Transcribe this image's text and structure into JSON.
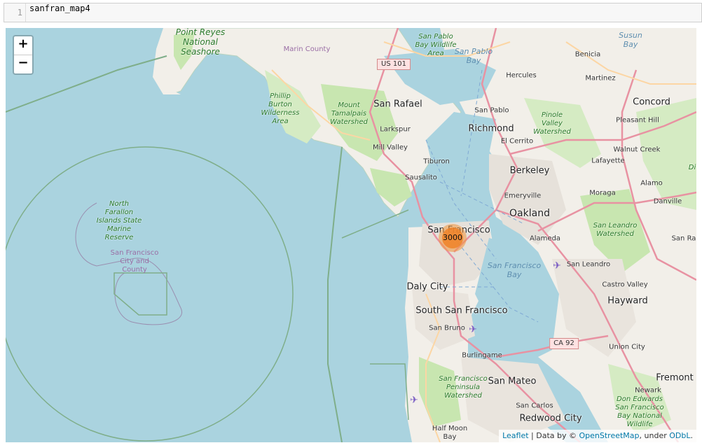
{
  "cell": {
    "line_number": "1",
    "code": "sanfran_map4"
  },
  "zoom": {
    "in_label": "+",
    "out_label": "−"
  },
  "cluster": {
    "count": "3000"
  },
  "attribution": {
    "leaflet": "Leaflet",
    "data_prefix": " | Data by © ",
    "osm": "OpenStreetMap",
    "under": ", under ",
    "odbl": "ODbL",
    "end": "."
  },
  "labels": {
    "point_reyes": "Point Reyes National Seashore",
    "marin_county": "Marin County",
    "us101": "US 101",
    "san_pablo_bay_wildlife": "San Pablo Bay Wildlife Area",
    "san_pablo_bay": "San Pablo Bay",
    "susun_bay": "Susun Bay",
    "benicia": "Benicia",
    "hercules": "Hercules",
    "martinez": "Martinez",
    "concord": "Concord",
    "phillip_burton": "Phillip Burton Wilderness Area",
    "mount_tamalpais": "Mount Tamalpais Watershed",
    "san_rafael": "San Rafael",
    "san_pablo": "San Pablo",
    "richmond": "Richmond",
    "pinole_valley": "Pinole Valley Watershed",
    "pleasant_hill": "Pleasant Hill",
    "larkspur": "Larkspur",
    "el_cerrito": "El Cerrito",
    "mill_valley": "Mill Valley",
    "walnut_creek": "Walnut Creek",
    "tiburon": "Tiburon",
    "lafayette": "Lafayette",
    "berkeley": "Berkeley",
    "sausalito": "Sausalito",
    "alamo": "Alamo",
    "emeryville": "Emeryville",
    "moraga": "Moraga",
    "danville": "Danville",
    "oakland": "Oakland",
    "north_farallon": "North Farallon Islands State Marine Reserve",
    "sf_city_county": "San Francisco City and County",
    "san_francisco": "San Francisco",
    "alameda": "Alameda",
    "san_leandro_watershed": "San Leandro Watershed",
    "san_ra": "San Ra",
    "sf_bay": "San Francisco Bay",
    "san_leandro": "San Leandro",
    "daly_city": "Daly City",
    "castro_valley": "Castro Valley",
    "hayward": "Hayward",
    "south_sf": "South San Francisco",
    "san_bruno": "San Bruno",
    "ca92": "CA 92",
    "union_city": "Union City",
    "burlingame": "Burlingame",
    "sf_peninsula_watershed": "San Francisco Peninsula Watershed",
    "san_mateo": "San Mateo",
    "fremont": "Fremont",
    "newark": "Newark",
    "don_edwards": "Don Edwards San Francisco Bay National Wildlife",
    "san_carlos": "San Carlos",
    "redwood_city": "Redwood City",
    "half_moon_bay": "Half Moon Bay",
    "di_edge": "Di"
  },
  "colors": {
    "ocean": "#aad3df",
    "land": "#f2efe9",
    "park": "#c8e6b0",
    "urban": "#e6e1da",
    "motorway": "#e892a2",
    "primary": "#fcd6a4",
    "boundary": "#7fae8a",
    "cluster": "#f0822a"
  }
}
